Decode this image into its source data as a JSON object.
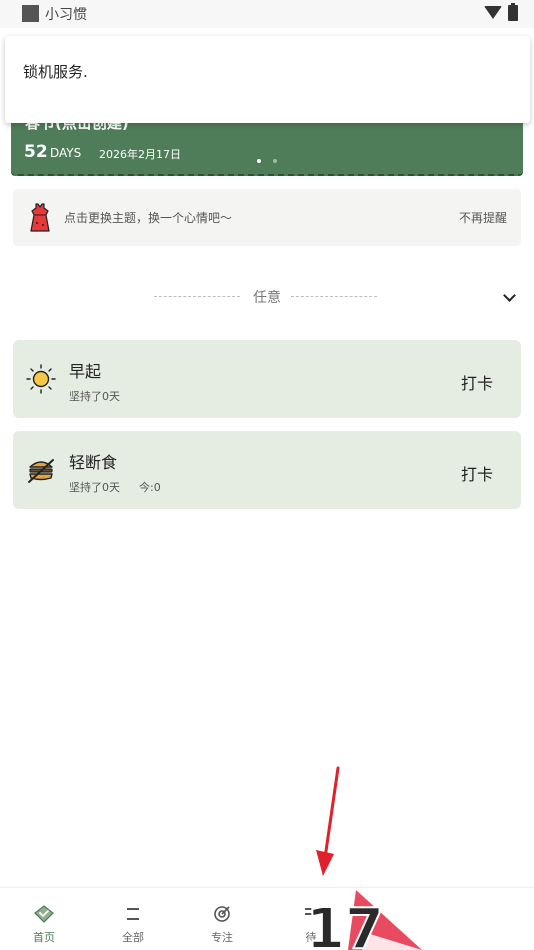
{
  "status_bar": {
    "app_name": "小习惯"
  },
  "toast": {
    "message": "锁机服务."
  },
  "banner": {
    "title": "春节(点击创建)",
    "days": "52",
    "days_unit": "DAYS",
    "date": "2026年2月17日"
  },
  "theme_tip": {
    "icon": "dress-icon",
    "text": "点击更换主题，换一个心情吧～",
    "dismiss_label": "不再提醒"
  },
  "section": {
    "title": "任意"
  },
  "habits": [
    {
      "name": "早起",
      "icon": "sun-icon",
      "streak": "坚持了0天",
      "today": "",
      "action": "打卡"
    },
    {
      "name": "轻断食",
      "icon": "burger-icon",
      "streak": "坚持了0天",
      "today": "今:0",
      "action": "打卡"
    }
  ],
  "bottom_nav": [
    {
      "label": "首页",
      "icon": "home-icon",
      "active": true
    },
    {
      "label": "全部",
      "icon": "list-icon",
      "active": false
    },
    {
      "label": "专注",
      "icon": "target-icon",
      "active": false
    },
    {
      "label": "待",
      "icon": "todo-icon",
      "active": false
    }
  ],
  "overlay": {
    "badge_text": "17"
  },
  "colors": {
    "accent_green": "#4f7d59",
    "card_green": "#e5ece2",
    "arrow_red": "#e0202a"
  }
}
